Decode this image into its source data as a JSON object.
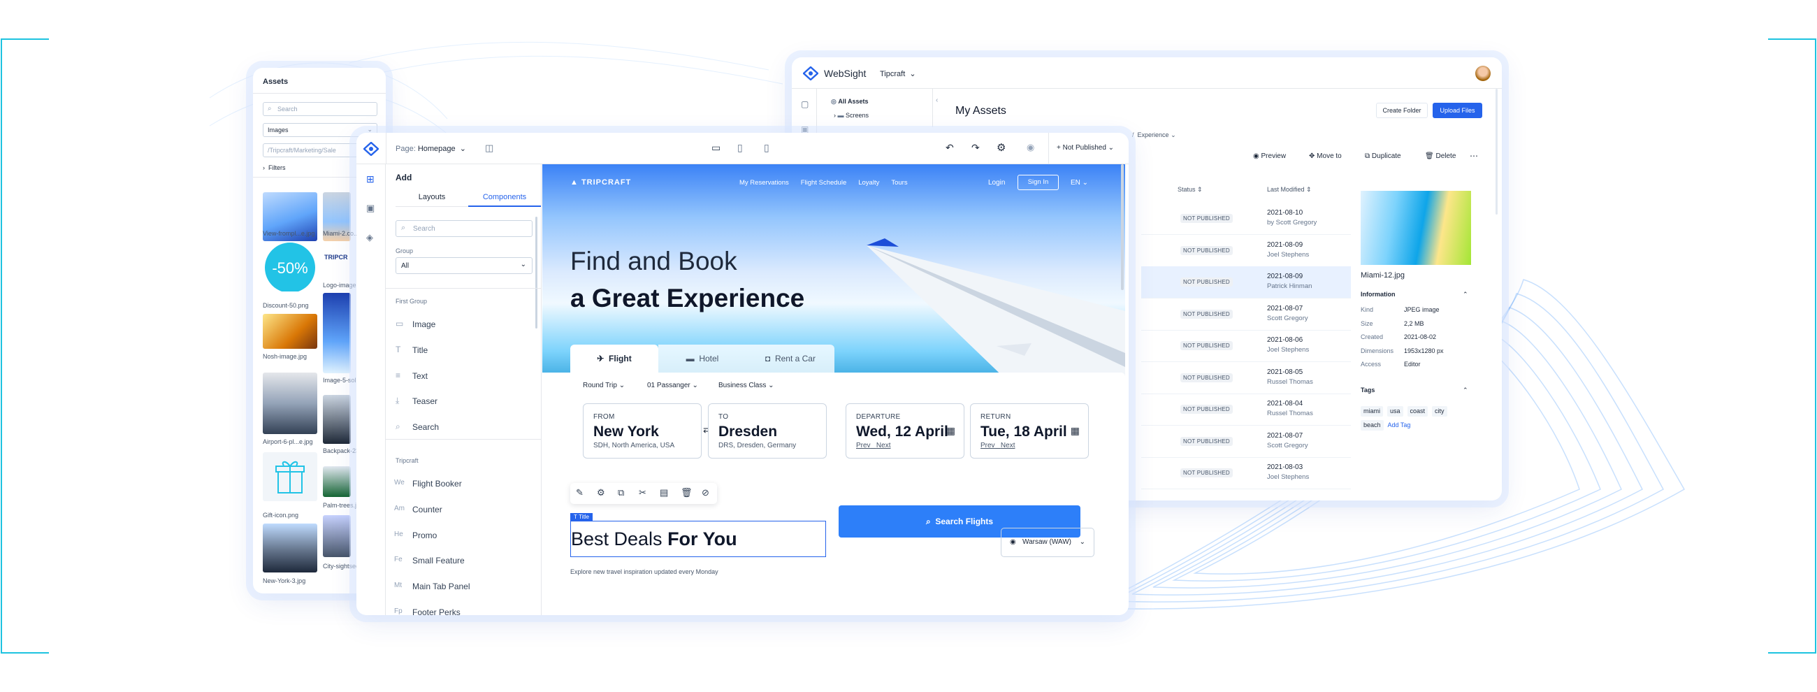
{
  "assets": {
    "title": "Assets",
    "search_placeholder": "Search",
    "type_value": "Images",
    "path_placeholder": "/Tripcraft/Marketing/Sale",
    "filters_label": "Filters",
    "files": [
      "View-frompl...e.jpg",
      "Miami-2.co...",
      "Discount-50.png",
      "Logo-image...",
      "Nosh-image.jpg",
      "Image-5-sol...",
      "Airport-6-pl...e.jpg",
      "Backpack-23...",
      "Gift-icon.png",
      "Palm-trees.jp...",
      "New-York-3.jpg",
      "City-sightsee..."
    ],
    "discount_text": "-50%",
    "logo_text": "TRIPCR"
  },
  "websight": {
    "brand": "WebSight",
    "project": "Tipcraft",
    "tree": {
      "all_assets": "All Assets",
      "screens": "Screens"
    },
    "page_title": "My Assets",
    "create_folder": "Create Folder",
    "upload_files": "Upload Files",
    "breadcrumb_sep": "/",
    "breadcrumb_current": "Experience",
    "actions": {
      "preview": "Preview",
      "move": "Move to",
      "duplicate": "Duplicate",
      "delete": "Delete"
    },
    "columns": {
      "status": "Status",
      "modified": "Last Modified"
    },
    "rows": [
      {
        "status": "NOT PUBLISHED",
        "date": "2021-08-10",
        "by": "by Scott Gregory"
      },
      {
        "status": "NOT PUBLISHED",
        "date": "2021-08-09",
        "by": "Joel Stephens"
      },
      {
        "status": "NOT PUBLISHED",
        "date": "2021-08-09",
        "by": "Patrick Hinman"
      },
      {
        "status": "NOT PUBLISHED",
        "date": "2021-08-07",
        "by": "Scott Gregory"
      },
      {
        "status": "NOT PUBLISHED",
        "date": "2021-08-06",
        "by": "Joel Stephens"
      },
      {
        "status": "NOT PUBLISHED",
        "date": "2021-08-05",
        "by": "Russel Thomas"
      },
      {
        "status": "NOT PUBLISHED",
        "date": "2021-08-04",
        "by": "Russel Thomas"
      },
      {
        "status": "NOT PUBLISHED",
        "date": "2021-08-07",
        "by": "Scott Gregory"
      },
      {
        "status": "NOT PUBLISHED",
        "date": "2021-08-03",
        "by": "Joel Stephens"
      }
    ],
    "details": {
      "filename": "Miami-12.jpg",
      "info_title": "Information",
      "info": [
        {
          "k": "Kind",
          "v": "JPEG image"
        },
        {
          "k": "Size",
          "v": "2,2 MB"
        },
        {
          "k": "Created",
          "v": "2021-08-02"
        },
        {
          "k": "Dimensions",
          "v": "1953x1280 px"
        },
        {
          "k": "Access",
          "v": "Editor"
        }
      ],
      "tags_title": "Tags",
      "tags": [
        "miami",
        "usa",
        "coast",
        "city",
        "beach"
      ],
      "add_tag": "Add Tag"
    }
  },
  "editor": {
    "page_label": "Page:",
    "page_name": "Homepage",
    "publish_status": "+ Not Published",
    "add_title": "Add",
    "tabs": [
      "Layouts",
      "Components"
    ],
    "search_placeholder": "Search",
    "group_label": "Group",
    "group_value": "All",
    "first_group": "First Group",
    "components": [
      {
        "ic": "▭",
        "label": "Image"
      },
      {
        "ic": "T",
        "label": "Title"
      },
      {
        "ic": "≡",
        "label": "Text"
      },
      {
        "ic": "⤓",
        "label": "Teaser"
      },
      {
        "ic": "⌕",
        "label": "Search"
      }
    ],
    "tripcraft_group": "Tripcraft",
    "tripcraft_components": [
      {
        "ic": "We",
        "label": "Flight Booker"
      },
      {
        "ic": "Am",
        "label": "Counter"
      },
      {
        "ic": "He",
        "label": "Promo"
      },
      {
        "ic": "Fe",
        "label": "Small Feature"
      },
      {
        "ic": "Mt",
        "label": "Main Tab Panel"
      },
      {
        "ic": "Fp",
        "label": "Footer Perks"
      }
    ]
  },
  "site": {
    "logo": "TRIPCRAFT",
    "nav": [
      "My Reservations",
      "Flight Schedule",
      "Loyalty",
      "Tours"
    ],
    "login": "Login",
    "signin": "Sign In",
    "lang": "EN",
    "hero_line1": "Find and Book",
    "hero_line2": "a Great Experience",
    "tabs": [
      "Flight",
      "Hotel",
      "Rent a Car"
    ],
    "options": [
      "Round Trip",
      "01 Passanger",
      "Business Class"
    ],
    "from": {
      "label": "FROM",
      "city": "New York",
      "sub": "SDH, North America, USA"
    },
    "to": {
      "label": "TO",
      "city": "Dresden",
      "sub": "DRS, Dresden, Germany"
    },
    "departure": {
      "label": "DEPARTURE",
      "date": "Wed, 12 April",
      "prev": "Prev",
      "next": "Next"
    },
    "return": {
      "label": "RETURN",
      "date": "Tue, 18 April",
      "prev": "Prev",
      "next": "Next"
    },
    "search_btn": "Search Flights",
    "title_tag": "Title",
    "deals_a": "Best Deals ",
    "deals_b": "For You",
    "deals_sub": "Explore new travel inspiration updated every Monday",
    "location": "Warsaw (WAW)"
  },
  "colors": {
    "accent": "#2563eb",
    "discount": "#22c3e6"
  }
}
